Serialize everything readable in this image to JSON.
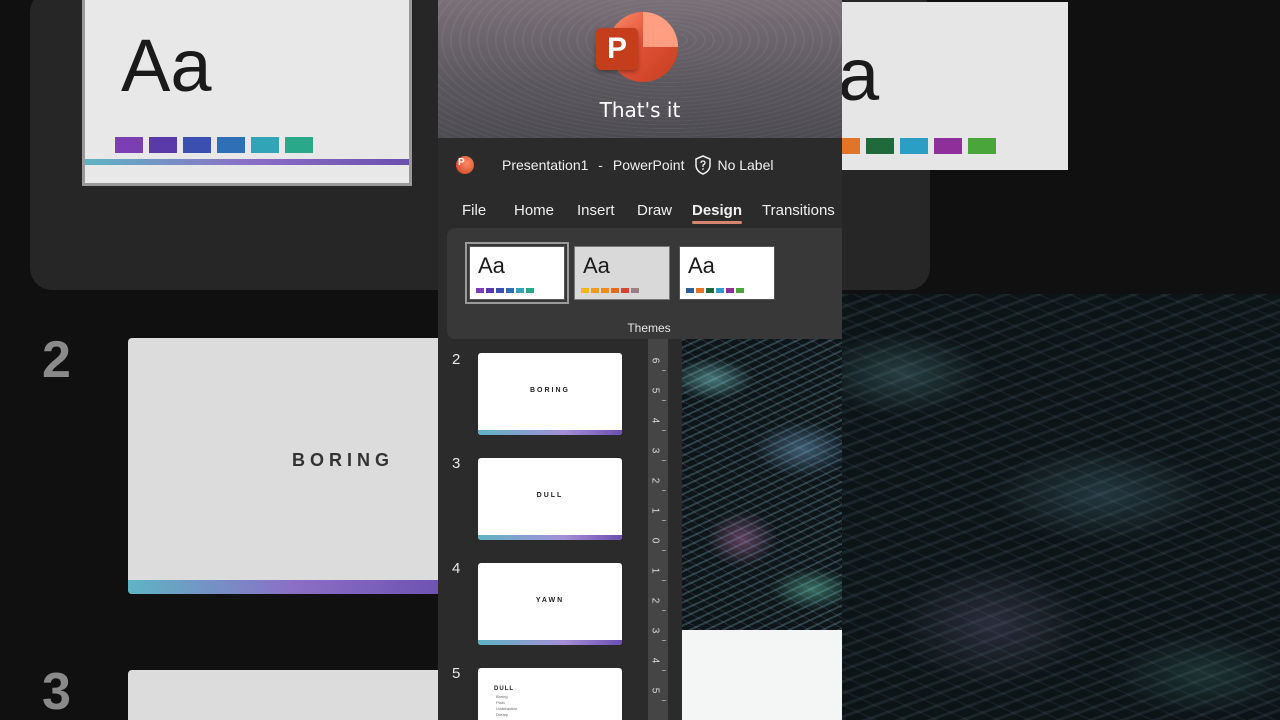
{
  "banner": {
    "caption": "That's it",
    "logo_letter": "P"
  },
  "titlebar": {
    "document": "Presentation1",
    "separator": "-",
    "app": "PowerPoint",
    "label": "No Label"
  },
  "tabs": [
    {
      "label": "File"
    },
    {
      "label": "Home"
    },
    {
      "label": "Insert"
    },
    {
      "label": "Draw"
    },
    {
      "label": "Design",
      "active": true
    },
    {
      "label": "Transitions"
    }
  ],
  "ribbon": {
    "group_label": "Themes",
    "themes": [
      {
        "sample": "Aa",
        "selected": true,
        "background": "#ffffff",
        "swatches": [
          "#7b3fb3",
          "#5a3aa8",
          "#3b4fb0",
          "#2f6fb5",
          "#31a4b8",
          "#2aa88a"
        ]
      },
      {
        "sample": "Aa",
        "selected": false,
        "background": "#d9d9d9",
        "swatches": [
          "#f2b61b",
          "#ef9a1a",
          "#e98b1f",
          "#e46a22",
          "#d9452a",
          "#9a7f82"
        ]
      },
      {
        "sample": "Aa",
        "selected": false,
        "background": "#ffffff",
        "swatches": [
          "#2f5f9e",
          "#e2742a",
          "#1e6a3a",
          "#2a9fc3",
          "#8e2f9a",
          "#4aa63a"
        ]
      }
    ]
  },
  "slides": [
    {
      "number": "2",
      "title": "BORING"
    },
    {
      "number": "3",
      "title": "DULL"
    },
    {
      "number": "4",
      "title": "YAWN"
    },
    {
      "number": "5",
      "title": "DULL",
      "bullets": [
        "Boring",
        "Plain",
        "Unattractive",
        "Dreary"
      ]
    }
  ],
  "ruler": {
    "marks": [
      "6",
      "5",
      "4",
      "3",
      "2",
      "1",
      "0",
      "1",
      "2",
      "3",
      "4",
      "5"
    ]
  },
  "background": {
    "theme_sample": "Aa",
    "theme_sample_right": "a",
    "slide_numbers": [
      "2",
      "3"
    ],
    "slide_word": "BORING",
    "swatches_left": [
      "#7b3fb3",
      "#5a3aa8",
      "#3b4fb0",
      "#2f6fb5",
      "#31a4b8",
      "#2aa88a"
    ],
    "swatches_right": [
      "#e2742a",
      "#1e6a3a",
      "#2a9fc3",
      "#8e2f9a",
      "#4aa63a"
    ]
  }
}
